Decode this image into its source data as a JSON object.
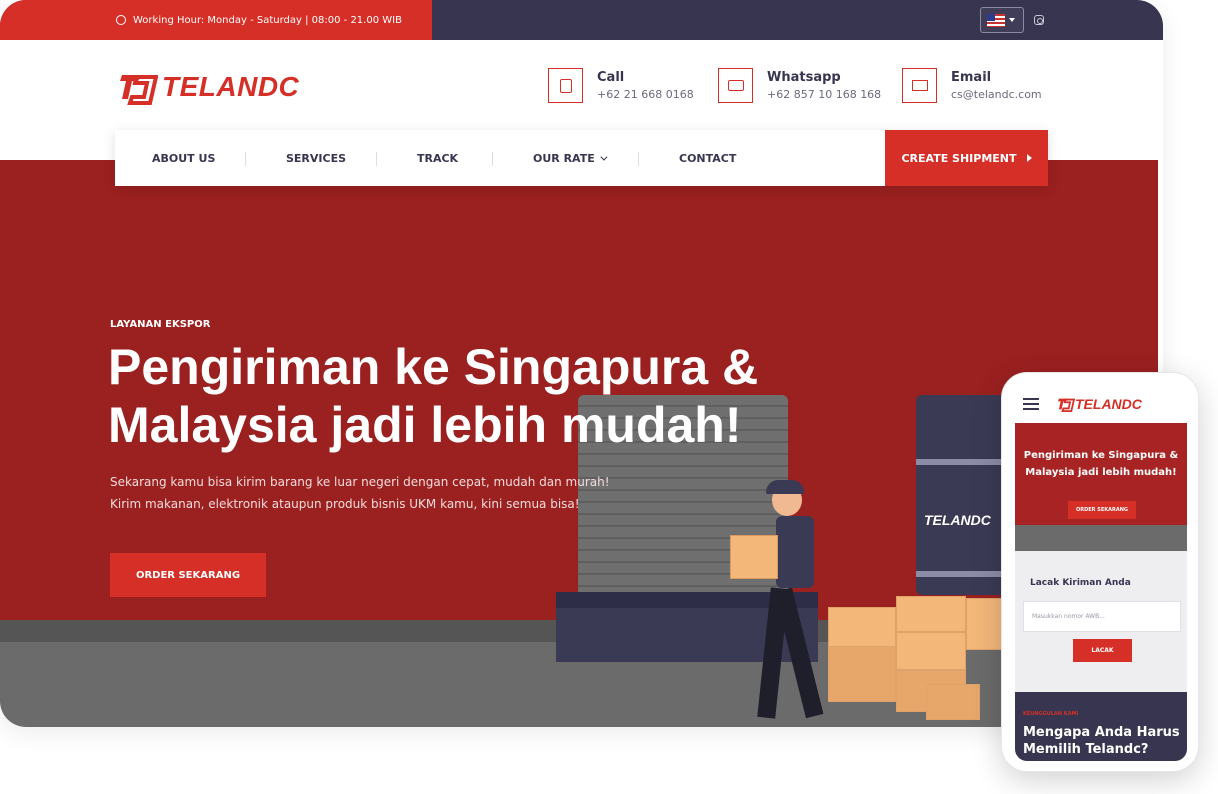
{
  "topbar": {
    "working_hours": "Working Hour: Monday - Saturday | 08:00 - 21.00 WIB",
    "language": "English (US)",
    "social": "instagram-icon"
  },
  "brand": {
    "name": "TELANDC",
    "color": "#d52f27",
    "dark": "#37354f"
  },
  "contacts": [
    {
      "label": "Call",
      "value": "+62 21 668 0168",
      "icon": "phone-icon"
    },
    {
      "label": "Whatsapp",
      "value": "+62 857 10 168 168",
      "icon": "chat-icon"
    },
    {
      "label": "Email",
      "value": "cs@telandc.com",
      "icon": "mail-icon"
    }
  ],
  "nav": {
    "items": [
      "ABOUT US",
      "SERVICES",
      "TRACK",
      "OUR RATE",
      "CONTACT"
    ],
    "cta": "CREATE SHIPMENT"
  },
  "hero": {
    "tag": "LAYANAN EKSPOR",
    "title_line1": "Pengiriman ke Singapura &",
    "title_line2": "Malaysia jadi lebih mudah!",
    "sub_line1": "Sekarang kamu bisa kirim barang ke luar negeri dengan cepat, mudah dan murah!",
    "sub_line2": "Kirim makanan, elektronik ataupun produk bisnis UKM kamu, kini semua bisa!",
    "cta": "ORDER SEKARANG",
    "container_logo": "TELANDC"
  },
  "mobile": {
    "logo": "TELANDC",
    "hero_title": "Pengiriman ke Singapura & Malaysia jadi lebih mudah!",
    "hero_cta": "ORDER SEKARANG",
    "track_title": "Lacak Kiriman Anda",
    "track_placeholder": "Masukkan nomor AWB...",
    "track_button": "LACAK",
    "why_tag": "KEUNGGULAN KAMI",
    "why_title": "Mengapa Anda Harus Memilih Telandc?"
  }
}
